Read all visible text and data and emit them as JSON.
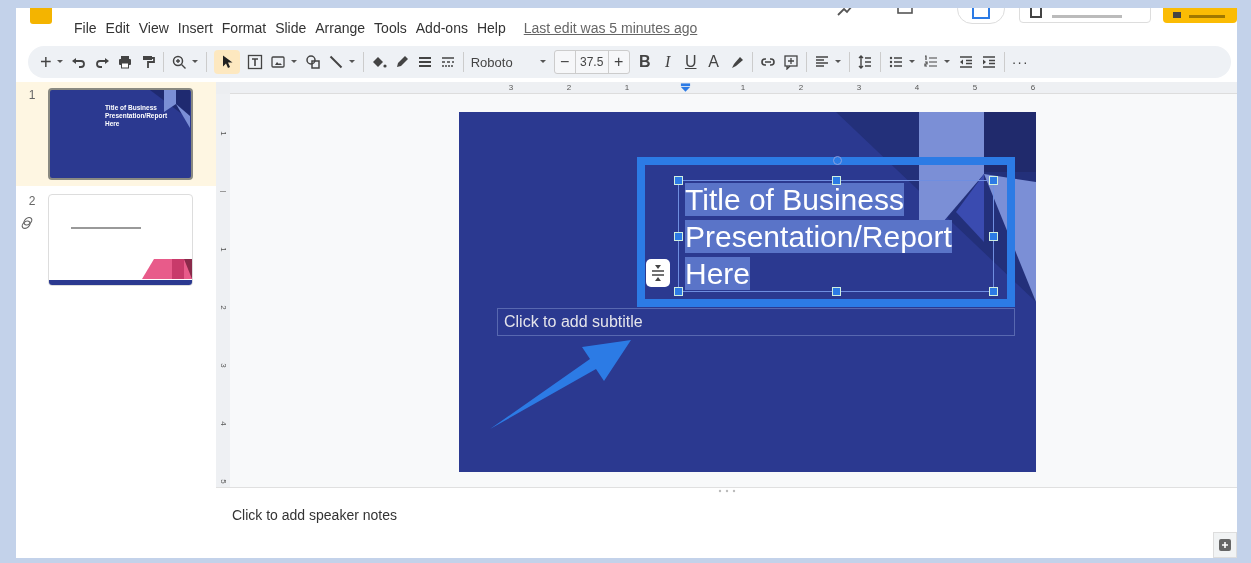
{
  "menu": {
    "items": [
      "File",
      "Edit",
      "View",
      "Insert",
      "Format",
      "Slide",
      "Arrange",
      "Tools",
      "Add-ons",
      "Help"
    ],
    "last_edit": "Last edit was 5 minutes ago"
  },
  "toolbar": {
    "new_slide": "+",
    "select_tool_active": true,
    "font": "Roboto",
    "size_minus": "−",
    "font_size": "37.5",
    "size_plus": "+",
    "format": [
      "B",
      "I",
      "U",
      "A"
    ],
    "more": "···"
  },
  "slides": [
    {
      "number": "1",
      "selected": true,
      "linked": false,
      "title": "Title of Business Presentation/Report Here"
    },
    {
      "number": "2",
      "selected": false,
      "linked": true
    }
  ],
  "ruler": {
    "horizontal": [
      {
        "label": "3"
      },
      {
        "label": "2"
      },
      {
        "label": "1"
      },
      {
        "kind": "indent"
      },
      {
        "label": "1"
      },
      {
        "label": "2"
      },
      {
        "label": "3"
      },
      {
        "label": "4"
      },
      {
        "label": "5"
      },
      {
        "label": "6"
      }
    ],
    "vertical": [
      {
        "label": "1"
      },
      {
        "kind": "origin"
      },
      {
        "label": "1"
      },
      {
        "label": "2"
      },
      {
        "label": "3"
      },
      {
        "label": "4"
      },
      {
        "label": "5"
      }
    ]
  },
  "slide": {
    "title": {
      "lines": [
        "Title of Business",
        "Presentation/Report",
        "Here"
      ],
      "selected": true
    },
    "subtitle": {
      "placeholder": "Click to add subtitle"
    }
  },
  "notes": {
    "placeholder": "Click to add speaker notes"
  }
}
